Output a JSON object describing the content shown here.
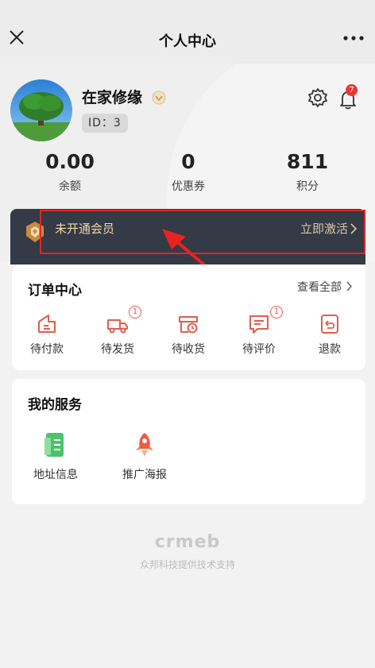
{
  "header": {
    "title": "个人中心"
  },
  "profile": {
    "name": "在家修缘",
    "id_text": "ID：3",
    "notification_count": "7"
  },
  "stats": [
    {
      "value": "0.00",
      "label": "余额"
    },
    {
      "value": "0",
      "label": "优惠券"
    },
    {
      "value": "811",
      "label": "积分"
    }
  ],
  "member": {
    "status": "未开通会员",
    "action": "立即激活"
  },
  "orders": {
    "title": "订单中心",
    "view_all": "查看全部",
    "items": [
      {
        "label": "待付款",
        "icon": "wallet-icon",
        "count": ""
      },
      {
        "label": "待发货",
        "icon": "truck-icon",
        "count": "1"
      },
      {
        "label": "待收货",
        "icon": "package-clock-icon",
        "count": ""
      },
      {
        "label": "待评价",
        "icon": "comment-icon",
        "count": "1"
      },
      {
        "label": "退款",
        "icon": "refund-icon",
        "count": ""
      }
    ]
  },
  "services": {
    "title": "我的服务",
    "items": [
      {
        "label": "地址信息",
        "icon": "address-book-icon"
      },
      {
        "label": "推广海报",
        "icon": "rocket-icon"
      }
    ]
  },
  "footer": {
    "logo": "crmeb",
    "note": "众邦科技提供技术支持"
  },
  "colors": {
    "accent": "#e45b4b",
    "member_bg": "#343a46",
    "member_text": "#f0d9a8",
    "highlight": "#e8231f"
  }
}
